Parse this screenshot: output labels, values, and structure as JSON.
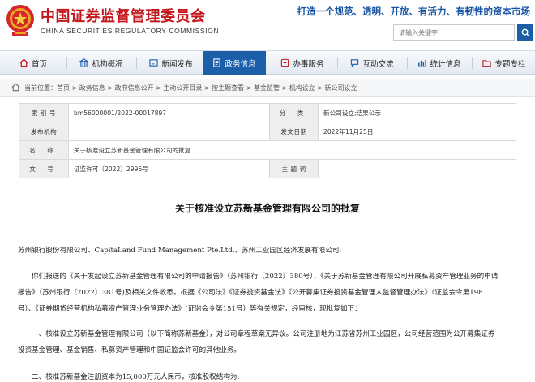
{
  "header": {
    "org_name_cn": "中国证券监督管理委员会",
    "org_name_en": "CHINA SECURITIES REGULATORY COMMISSION",
    "slogan": "打造一个规范、透明、开放、有活力、有韧性的资本市场",
    "search_placeholder": "请输入关键字",
    "search_icon": "search-icon",
    "emblem_icon": "national-emblem-icon"
  },
  "nav": {
    "items": [
      {
        "label": "首页",
        "icon": "home-icon"
      },
      {
        "label": "机构概况",
        "icon": "building-icon"
      },
      {
        "label": "新闻发布",
        "icon": "newspaper-icon"
      },
      {
        "label": "政务信息",
        "icon": "document-icon"
      },
      {
        "label": "办事服务",
        "icon": "service-icon"
      },
      {
        "label": "互动交流",
        "icon": "chat-icon"
      },
      {
        "label": "统计信息",
        "icon": "chart-icon"
      },
      {
        "label": "专题专栏",
        "icon": "folder-icon"
      }
    ],
    "active_index": 3,
    "active_color": "#1d5ea8"
  },
  "breadcrumb": {
    "text": "当前位置：首页 > 政务信息 > 政府信息公开 > 主动公开目录 > 按主题查看 > 基金监管 > 机构设立 > 新公司设立"
  },
  "info": {
    "index_label": "索 引 号",
    "index_value": "bm56000001/2022-00017897",
    "category_label": "分 类",
    "category_value": "新公司设立;结果公示",
    "issuer_label": "发布机构",
    "issuer_value": "",
    "date_label": "发文日期",
    "date_value": "2022年11月25日",
    "name_label": "名 称",
    "name_value": "关于核准设立苏新基金管理有限公司的批复",
    "docno_label": "文 号",
    "docno_value": "证监许可〔2022〕2996号",
    "subject_label": "主 题 词",
    "subject_value": ""
  },
  "article": {
    "title": "关于核准设立苏新基金管理有限公司的批复",
    "addressee": "苏州银行股份有限公司、CapitaLand Fund Management Pte.Ltd.、苏州工业园区经济发展有限公司:",
    "p1_lines": [
      "你们报送的《关于发起设立苏新基金管理有限公司的申请报告》（苏州银行〔2022〕380号）、《关于苏新基金管理有限公司开展私募资产管理业务的申请",
      "报告》（苏州银行〔2022〕381号)及相关文件收悉。根据《公司法》《证券投资基金法》《公开募集证券投资基金管理人监督管理办法》（证监会令第198",
      "号）、《证券期货经营机构私募资产管理业务管理办法》(证监会令第151号）等有关规定，经审核，现批复如下："
    ],
    "p2_lines": [
      "一、核准设立苏新基金管理有限公司（以下简称苏新基金），对公司章程草案无异议。公司注册地为江苏省苏州工业园区，公司经营范围为公开募集证券",
      "投资基金管理、基金销售、私募资产管理和中国证监会许可的其他业务。"
    ],
    "p3": "二、核准苏新基金注册资本为15,000万元人民币，核准股权结构为:"
  }
}
